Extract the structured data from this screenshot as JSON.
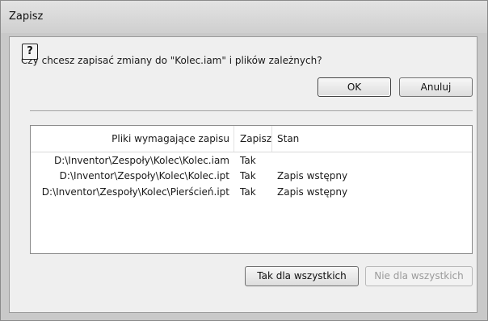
{
  "window": {
    "title": "Zapisz"
  },
  "prompt": {
    "question": "Czy chcesz zapisać zmiany do \"Kolec.iam\" i plików zależnych?"
  },
  "buttons": {
    "help_label": "?",
    "ok_label": "OK",
    "cancel_label": "Anuluj",
    "yes_all_label": "Tak dla wszystkich",
    "no_all_label": "Nie dla wszystkich"
  },
  "table": {
    "columns": [
      "Pliki wymagające zapisu",
      "Zapisz",
      "Stan"
    ],
    "rows": [
      {
        "path": "D:\\Inventor\\Zespoły\\Kolec\\Kolec.iam",
        "save": "Tak",
        "state": ""
      },
      {
        "path": "D:\\Inventor\\Zespoły\\Kolec\\Kolec.ipt",
        "save": "Tak",
        "state": "Zapis wstępny"
      },
      {
        "path": "D:\\Inventor\\Zespoły\\Kolec\\Pierścień.ipt",
        "save": "Tak",
        "state": "Zapis wstępny"
      }
    ]
  },
  "state": {
    "no_all_enabled": false,
    "default_button": "ok"
  }
}
